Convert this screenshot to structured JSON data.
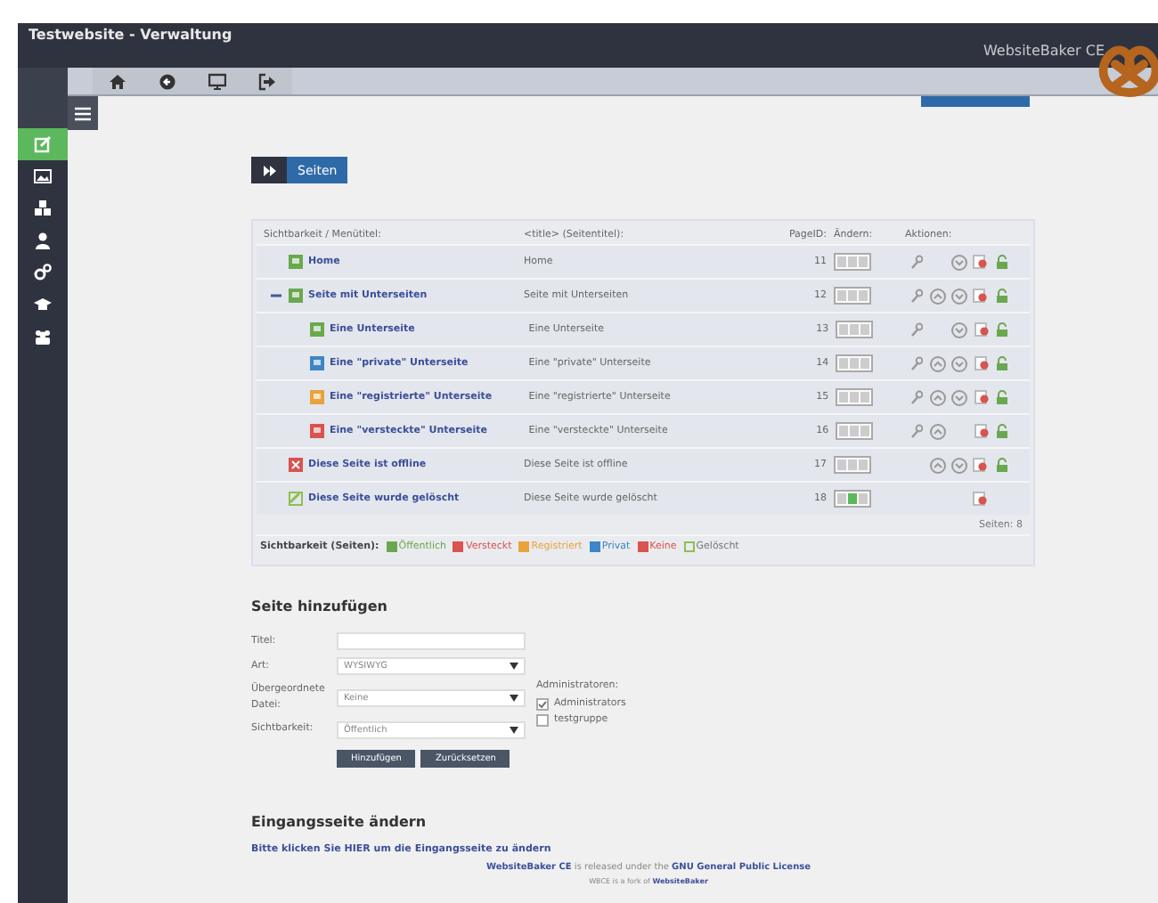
{
  "header": {
    "title": "Testwebsite - Verwaltung",
    "brand": "WebsiteBaker CE"
  },
  "sidebar": {
    "items": [
      {
        "selected": true
      },
      {
        "selected": false
      },
      {
        "selected": false
      },
      {
        "selected": false
      },
      {
        "selected": false
      },
      {
        "selected": false
      },
      {
        "selected": false
      }
    ]
  },
  "breadcrumb": {
    "label": "Seiten"
  },
  "pages": {
    "columns": [
      "Sichtbarkeit / Menütitel:",
      "<title> (Seitentitel):",
      "PageID:",
      "Ändern:",
      "Aktionen:"
    ],
    "rows": [
      {
        "menu_title": "Home",
        "page_title": "Home",
        "id": "11",
        "kind": "public",
        "actions": {
          "settings": true,
          "up": false,
          "down": true,
          "delete": true,
          "lock": true
        }
      },
      {
        "menu_title": "Seite mit Unterseiten",
        "page_title": "Seite mit Unterseiten",
        "id": "12",
        "kind": "public",
        "expanded": true,
        "actions": {
          "settings": true,
          "up": true,
          "down": true,
          "delete": true,
          "lock": true
        },
        "children": [
          {
            "menu_title": "Eine Unterseite",
            "page_title": "Eine Unterseite",
            "id": "13",
            "kind": "public",
            "actions": {
              "settings": true,
              "up": false,
              "down": true,
              "delete": true,
              "lock": true
            }
          },
          {
            "menu_title": "Eine \"private\" Unterseite",
            "page_title": "Eine \"private\" Unterseite",
            "id": "14",
            "kind": "private",
            "actions": {
              "settings": true,
              "up": true,
              "down": true,
              "delete": true,
              "lock": true
            }
          },
          {
            "menu_title": "Eine \"registrierte\" Unterseite",
            "page_title": "Eine \"registrierte\" Unterseite",
            "id": "15",
            "kind": "registered",
            "actions": {
              "settings": true,
              "up": true,
              "down": true,
              "delete": true,
              "lock": true
            }
          },
          {
            "menu_title": "Eine \"versteckte\" Unterseite",
            "page_title": "Eine \"versteckte\" Unterseite",
            "id": "16",
            "kind": "hidden",
            "actions": {
              "settings": true,
              "up": true,
              "down": false,
              "delete": true,
              "lock": true
            }
          }
        ]
      },
      {
        "menu_title": "Diese Seite ist offline",
        "page_title": "Diese Seite ist offline",
        "id": "17",
        "kind": "none",
        "actions": {
          "settings": false,
          "up": true,
          "down": true,
          "delete": true,
          "lock": true
        }
      },
      {
        "menu_title": "Diese Seite wurde gelöscht",
        "page_title": "Diese Seite wurde gelöscht",
        "id": "18",
        "kind": "deleted",
        "actions": {
          "settings": false,
          "up": false,
          "down": false,
          "delete": true,
          "lock": false
        }
      }
    ],
    "count": "Seiten: 8",
    "legend_label": "Sichtbarkeit (Seiten):",
    "legend": [
      {
        "label": "Öffentlich",
        "kind": "public"
      },
      {
        "label": "Versteckt",
        "kind": "hidden"
      },
      {
        "label": "Registriert",
        "kind": "registered"
      },
      {
        "label": "Privat",
        "kind": "private"
      },
      {
        "label": "Keine",
        "kind": "none"
      },
      {
        "label": "Gelöscht",
        "kind": "deleted"
      }
    ]
  },
  "add_page": {
    "heading": "Seite hinzufügen",
    "fields": [
      {
        "label": "Titel:",
        "kind": "text"
      },
      {
        "label": "Art:",
        "kind": "select",
        "value": "WYSIWYG"
      },
      {
        "label": "Übergeordnete Datei:",
        "kind": "select",
        "value": "Keine"
      },
      {
        "label": "Sichtbarkeit:",
        "kind": "select",
        "value": "Öffentlich"
      }
    ],
    "admins_label": "Administratoren:",
    "groups": [
      {
        "label": "Administrators",
        "checked": true
      },
      {
        "label": "testgruppe",
        "checked": false
      }
    ],
    "buttons": [
      "Hinzufügen",
      "Zurücksetzen"
    ]
  },
  "start_page": {
    "heading": "Eingangsseite ändern",
    "link": "Bitte klicken Sie HIER um die Eingangsseite zu ändern"
  },
  "footer": {
    "line": "**WebsiteBaker CE** is released under the **GNU General Public License**",
    "small": "WBCE is a fork of **WebsiteBaker**"
  }
}
